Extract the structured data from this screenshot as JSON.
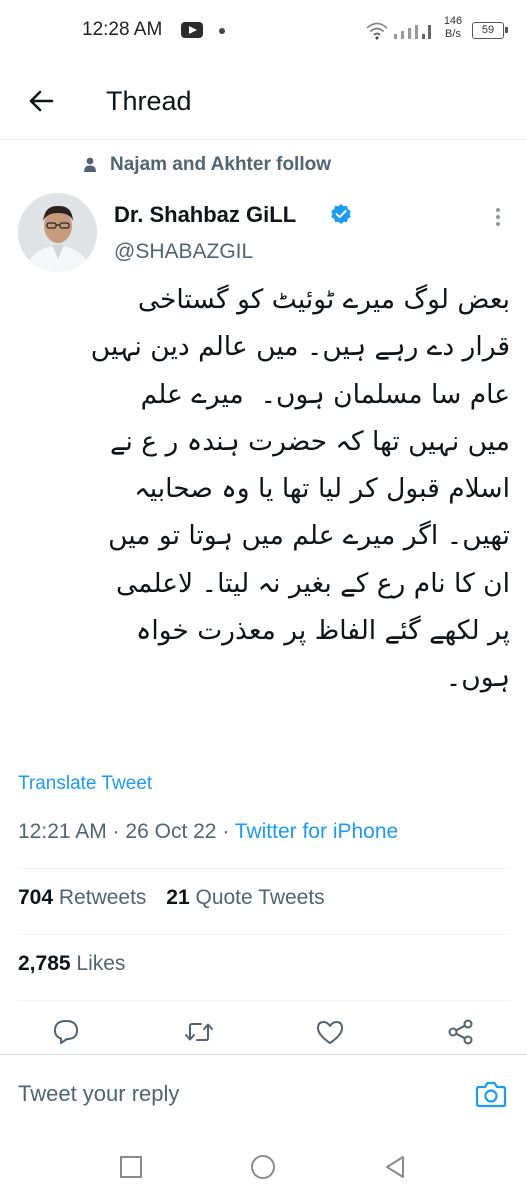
{
  "status_bar": {
    "time": "12:28 AM",
    "net_speed_value": "146",
    "net_speed_unit": "B/s",
    "battery": "59",
    "icons": [
      "youtube-icon",
      "dot-icon",
      "wifi-icon",
      "signal-icon",
      "battery-icon"
    ]
  },
  "header": {
    "title": "Thread",
    "back_icon": "arrow-left-icon"
  },
  "social_context": {
    "text": "Najam and Akhter follow",
    "icon": "person-icon"
  },
  "author": {
    "name": "Dr. Shahbaz GiLL",
    "handle": "@SHABAZGIL",
    "verified": true,
    "verified_color": "#1d9bf0"
  },
  "tweet": {
    "text": "بعض لوگ میرے ٹوئیٹ کو گستاخی\nقرار دے رہے ہیں۔ میں عالم دین نہیں\nعام سا مسلمان ہوں۔  میرے علم\nمیں نہیں تھا کہ حضرت ہندہ ر ع نے\nاسلام قبول کر لیا تھا یا وہ صحابیہ\nتھیں۔ اگر میرے علم میں ہوتا تو میں\nان کا نام رع کے بغیر نہ لیتا۔ لاعلمی\nپر لکھے گئے الفاظ پر معذرت خواہ\nہوں۔",
    "translate_label": "Translate Tweet",
    "time": "12:21 AM",
    "date": "26 Oct 22",
    "separator": "·",
    "source": "Twitter for iPhone"
  },
  "stats": {
    "retweets_count": "704",
    "retweets_label": "Retweets",
    "quotes_count": "21",
    "quotes_label": "Quote Tweets",
    "likes_count": "2,785",
    "likes_label": "Likes"
  },
  "actions": [
    "reply-icon",
    "retweet-icon",
    "like-icon",
    "share-icon"
  ],
  "reply": {
    "placeholder": "Tweet your reply",
    "camera_icon": "camera-icon",
    "accent": "#1d9bf0"
  },
  "navbar": [
    "recents-square-icon",
    "home-circle-icon",
    "back-triangle-icon"
  ]
}
